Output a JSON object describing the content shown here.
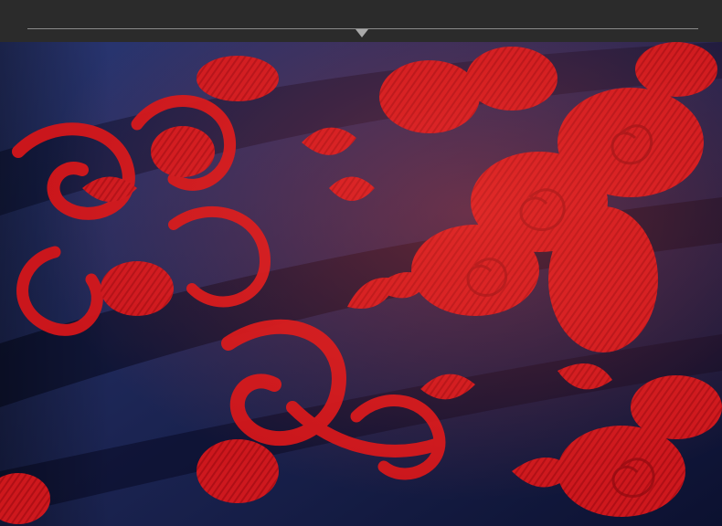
{
  "photo": {
    "subject": "embroidered-fabric",
    "colors": {
      "fabric": "#1c2654",
      "embroidery": "#d61818",
      "top_bar": "#2b2b2b",
      "rule": "#8a8a8a"
    }
  }
}
